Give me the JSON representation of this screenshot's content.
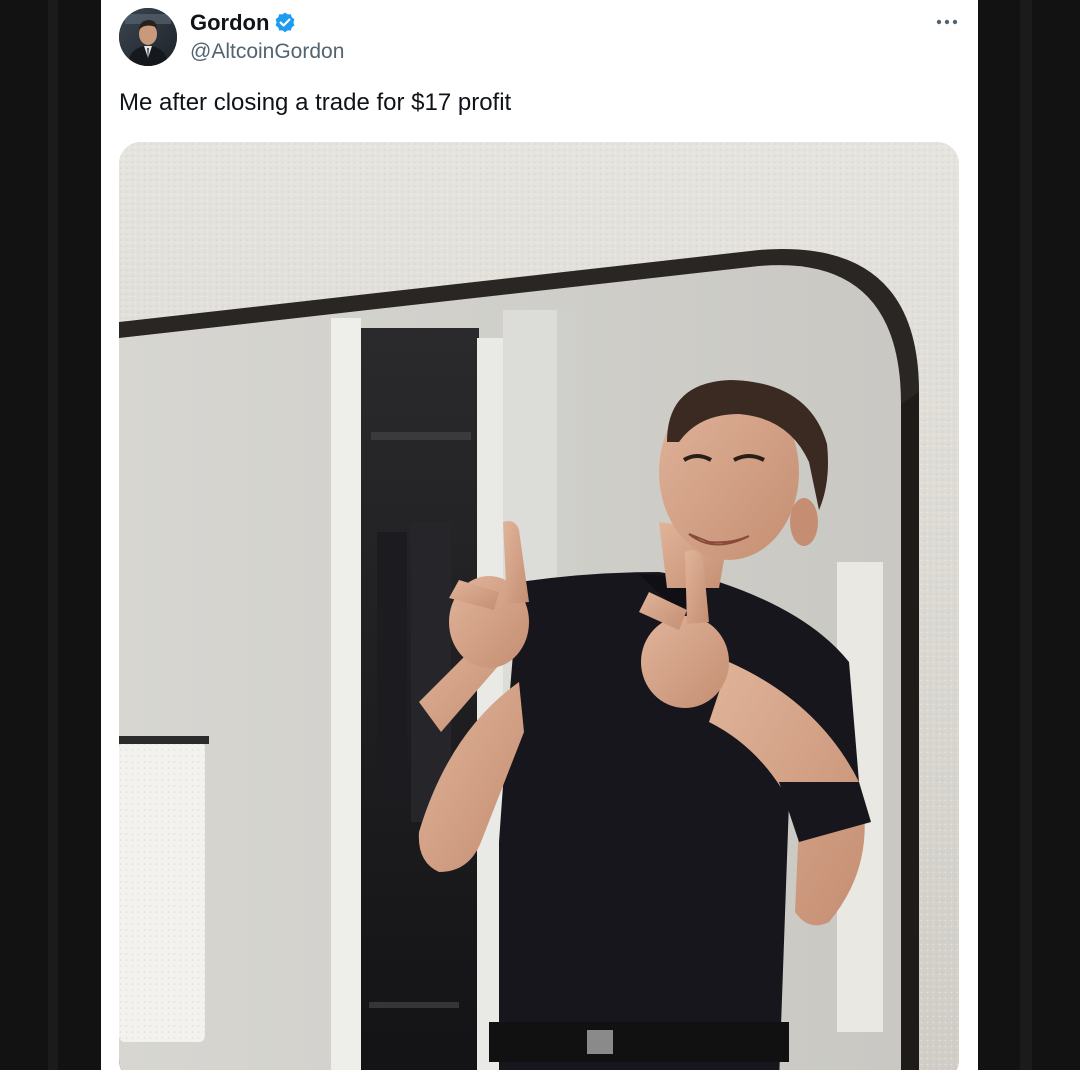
{
  "tweet": {
    "author": {
      "name": "Gordon",
      "handle": "@AltcoinGordon",
      "verified": true
    },
    "text": "Me after closing a trade for $17 profit",
    "media_description": "photo: man in black polo pointing finger guns at bathroom mirror"
  },
  "theme": {
    "page_bg": "#121212",
    "card_bg": "#ffffff",
    "text_primary": "#0f1419",
    "text_secondary": "#536471",
    "verified_color": "#1d9bf0"
  },
  "icons": {
    "verified": "verified-badge-icon",
    "more": "more-icon"
  }
}
